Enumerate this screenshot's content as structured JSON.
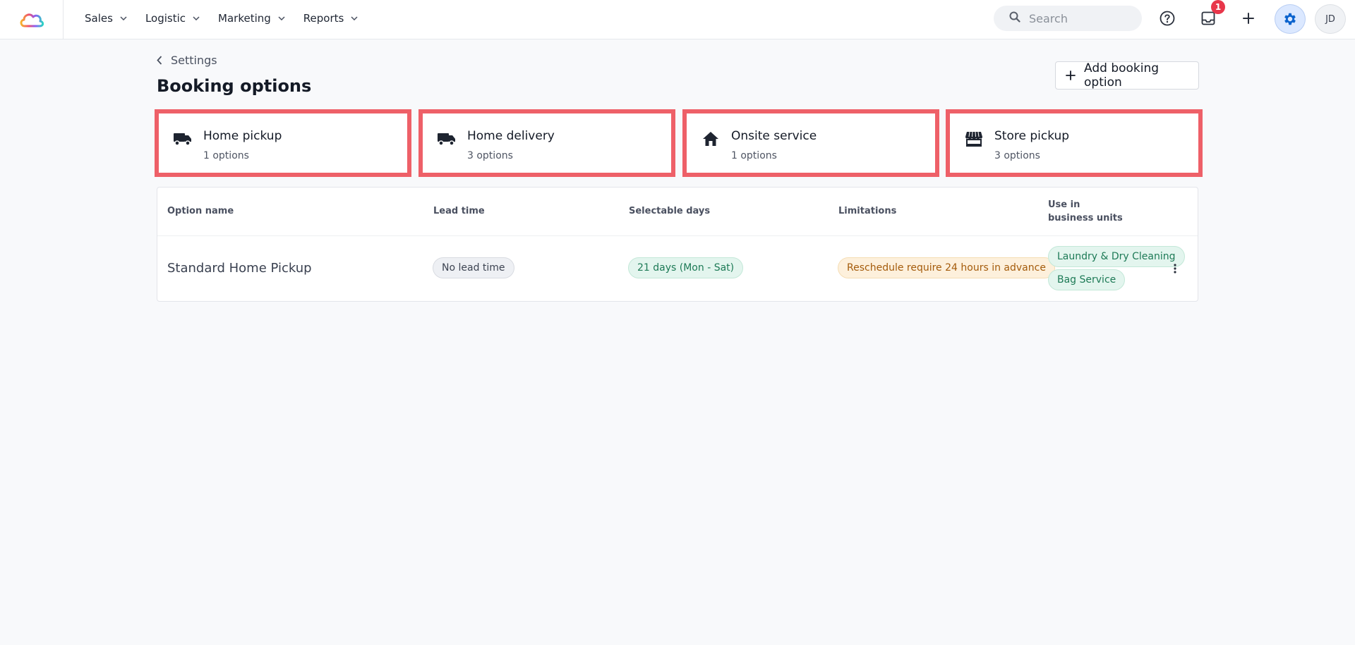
{
  "nav": {
    "items": [
      {
        "label": "Sales"
      },
      {
        "label": "Logistic"
      },
      {
        "label": "Marketing"
      },
      {
        "label": "Reports"
      }
    ]
  },
  "search": {
    "placeholder": "Search"
  },
  "inbox": {
    "badge": "1"
  },
  "user": {
    "initials": "JD"
  },
  "header": {
    "breadcrumb": "Settings",
    "title": "Booking options",
    "add_button": "Add booking option"
  },
  "cards": [
    {
      "title": "Home pickup",
      "subtitle": "1 options",
      "icon": "truck-icon"
    },
    {
      "title": "Home delivery",
      "subtitle": "3 options",
      "icon": "truck-icon"
    },
    {
      "title": "Onsite service",
      "subtitle": "1 options",
      "icon": "house-icon"
    },
    {
      "title": "Store pickup",
      "subtitle": "3 options",
      "icon": "store-icon"
    }
  ],
  "table": {
    "columns": [
      "Option name",
      "Lead time",
      "Selectable days",
      "Limitations",
      "Use in business units"
    ],
    "rows": [
      {
        "name": "Standard Home Pickup",
        "lead_time": "No lead time",
        "selectable_days": "21 days (Mon - Sat)",
        "limitations": "Reschedule require 24 hours in advance",
        "business_units": [
          "Laundry & Dry Cleaning",
          "Bag Service"
        ]
      }
    ]
  },
  "colors": {
    "accent": "#0b63ce",
    "highlight_border": "#ee6068",
    "badge": "#e8364a"
  }
}
